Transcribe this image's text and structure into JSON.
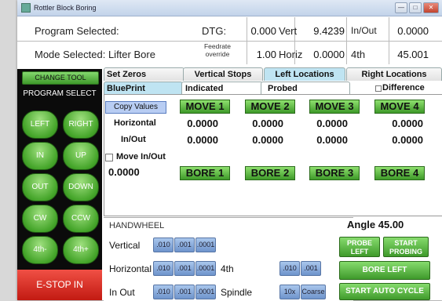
{
  "window": {
    "title": "Rottler Block Boring",
    "min": "—",
    "max": "□",
    "close": "✕"
  },
  "status": {
    "program_label": "Program Selected:",
    "mode_label": "Mode Selected: Lifter Bore",
    "dtg_label": "DTG:",
    "dtg_value": "0.000",
    "feedrate_label": "Feedrate override",
    "feedrate_value": "1.00",
    "vert_label": "Vert",
    "vert_value": "9.4239",
    "horiz_label": "Horiz",
    "horiz_value": "0.0000",
    "inout_label": "In/Out",
    "inout_value": "0.0000",
    "fourth_label": "4th",
    "fourth_value": "45.001"
  },
  "left_panel": {
    "change_tool": "CHANGE TOOL",
    "program_select": "PROGRAM SELECT",
    "buttons": [
      "LEFT",
      "RIGHT",
      "IN",
      "UP",
      "OUT",
      "DOWN",
      "CW",
      "CCW",
      "4th-",
      "4th+"
    ],
    "estop": "E-STOP IN"
  },
  "tabs_top": [
    "Set Zeros",
    "Vertical Stops",
    "Left Locations",
    "Right Locations"
  ],
  "tabs_sub": [
    "BluePrint",
    "Indicated",
    "Probed"
  ],
  "difference_label": "Difference",
  "blueprint": {
    "copy_values": "Copy Values",
    "moves": [
      "MOVE 1",
      "MOVE 2",
      "MOVE 3",
      "MOVE 4"
    ],
    "horizontal_label": "Horizontal",
    "inout_label": "In/Out",
    "move_inout_label": "Move In/Out",
    "horizontal_values": [
      "0.0000",
      "0.0000",
      "0.0000",
      "0.0000"
    ],
    "inout_values": [
      "0.0000",
      "0.0000",
      "0.0000",
      "0.0000"
    ],
    "move_inout_value": "0.0000",
    "bores": [
      "BORE 1",
      "BORE 2",
      "BORE 3",
      "BORE 4"
    ]
  },
  "handwheel": {
    "title": "HANDWHEEL",
    "vertical_label": "Vertical",
    "horizontal_label": "Horizontal",
    "inout_label": "In Out",
    "fourth_label": "4th",
    "spindle_label": "Spindle",
    "vertical_steps": [
      ".010",
      ".001",
      ".0001"
    ],
    "horizontal_steps": [
      ".010",
      ".001",
      ".0001"
    ],
    "inout_steps": [
      ".010",
      ".001",
      ".0001"
    ],
    "fourth_steps": [
      ".010",
      ".001"
    ],
    "spindle_steps": [
      "10x",
      "Coarse"
    ]
  },
  "right_actions": {
    "angle_label": "Angle",
    "angle_value": "45.00",
    "probe_left": "PROBE LEFT",
    "start_probing": "START PROBING",
    "bore_left": "BORE LEFT",
    "start_auto_cycle": "START AUTO CYCLE"
  }
}
